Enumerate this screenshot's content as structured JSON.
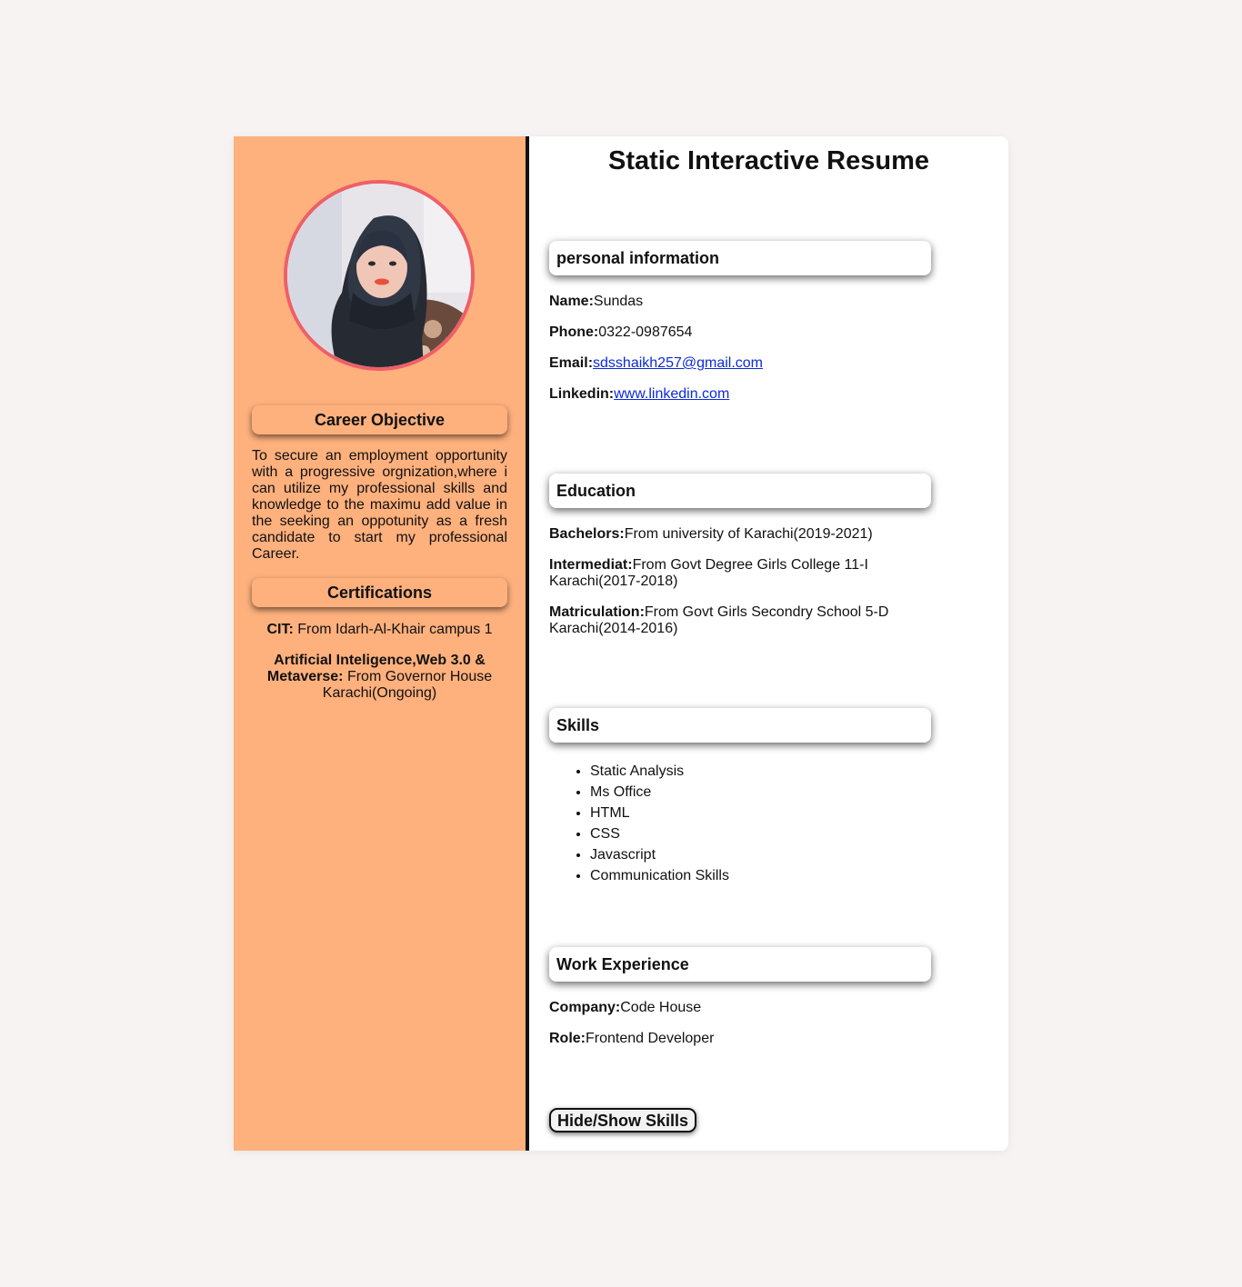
{
  "title": "Static Interactive Resume",
  "sidebar": {
    "career_heading": "Career Objective",
    "career_text": "To secure an employment opportunity with a progressive orgnization,where i can utilize my professional skills and knowledge to the maximu add value in the seeking an oppotunity as a fresh candidate to start my professional Career.",
    "cert_heading": "Certifications",
    "certs": [
      {
        "label": "CIT:",
        "value": " From Idarh-Al-Khair campus 1"
      },
      {
        "label": "Artificial Inteligence,Web 3.0 & Metaverse:",
        "value": " From Governor House Karachi(Ongoing)"
      }
    ]
  },
  "personal": {
    "heading": "personal information",
    "name_label": "Name:",
    "name": "Sundas",
    "phone_label": "Phone:",
    "phone": "0322-0987654",
    "email_label": "Email:",
    "email": "sdsshaikh257@gmail.com",
    "linkedin_label": "Linkedin:",
    "linkedin": "www.linkedin.com"
  },
  "education": {
    "heading": "Education",
    "items": [
      {
        "label": "Bachelors:",
        "value": "From university of Karachi(2019-2021)"
      },
      {
        "label": "Intermediat:",
        "value": "From Govt Degree Girls College 11-I Karachi(2017-2018)"
      },
      {
        "label": "Matriculation:",
        "value": "From Govt Girls Secondry School 5-D Karachi(2014-2016)"
      }
    ]
  },
  "skills": {
    "heading": "Skills",
    "items": [
      "Static Analysis",
      "Ms Office",
      "HTML",
      "CSS",
      "Javascript",
      "Communication Skills"
    ]
  },
  "work": {
    "heading": "Work Experience",
    "company_label": "Company:",
    "company": "Code House",
    "role_label": "Role:",
    "role": "Frontend Developer"
  },
  "toggle_button": "Hide/Show Skills",
  "colors": {
    "sidebar_bg": "#feb07d",
    "avatar_border": "#ef5f67",
    "link": "#0b2ad8",
    "page_bg": "#f6f3f2"
  },
  "icons": {
    "avatar": "profile-photo"
  }
}
